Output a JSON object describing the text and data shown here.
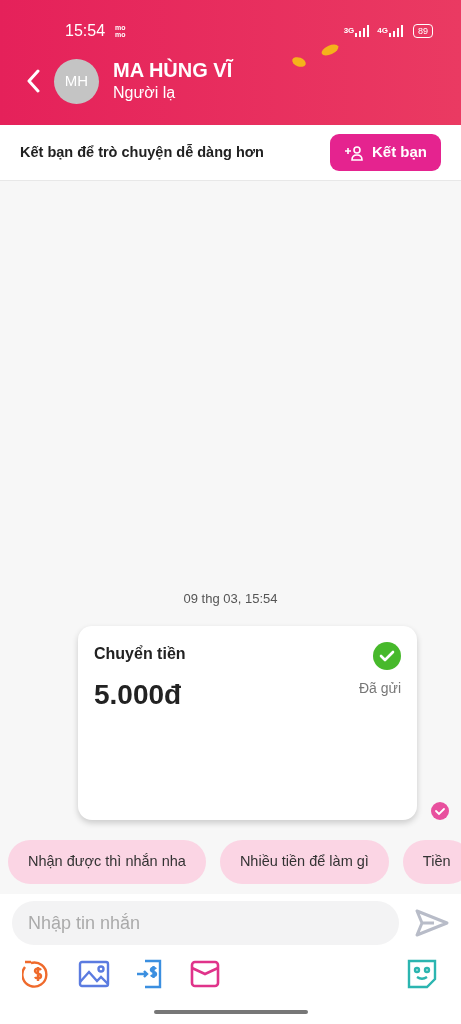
{
  "status_bar": {
    "time": "15:54",
    "app_logo": [
      "mo",
      "mo"
    ],
    "networks": [
      "3G",
      "4G"
    ],
    "battery": "89"
  },
  "header": {
    "avatar_initials": "MH",
    "name": "MA HÙNG VĨ",
    "subtitle": "Người lạ"
  },
  "friend_bar": {
    "text": "Kết bạn để trò chuyện dễ dàng hơn",
    "button": "Kết bạn"
  },
  "chat": {
    "timestamp": "09 thg 03, 15:54",
    "messages": [
      {
        "kind": "transfer",
        "title": "Chuyển tiền",
        "amount": "5.000đ",
        "status": "Đã gửi",
        "completed": true,
        "delivered": true
      }
    ]
  },
  "suggestions": [
    "Nhận được thì nhắn nha",
    "Nhiều tiền để làm gì",
    "Tiền"
  ],
  "composer": {
    "placeholder": "Nhập tin nhắn"
  }
}
